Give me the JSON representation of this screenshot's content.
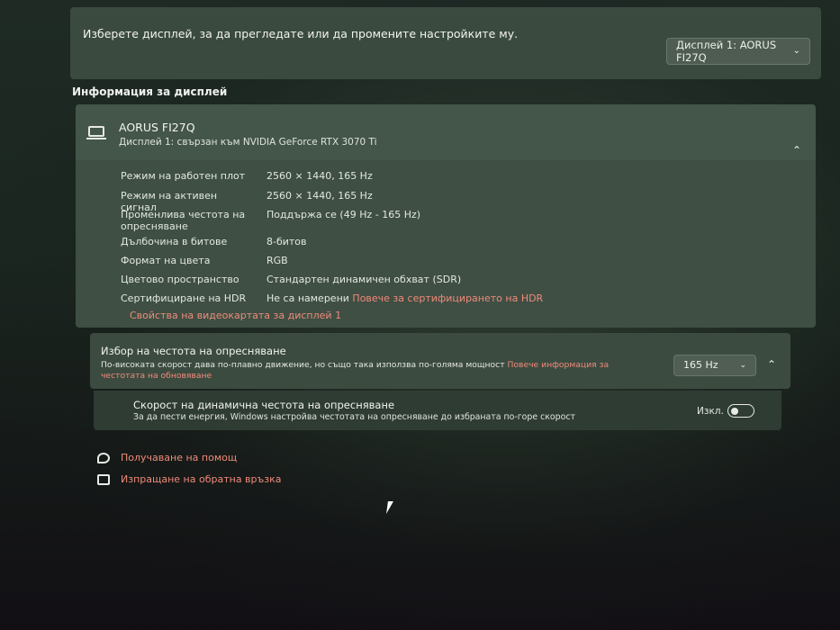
{
  "top_panel": {
    "prompt": "Изберете дисплей, за да прегледате или да промените настройките му.",
    "display_select": "Дисплей 1: AORUS FI27Q"
  },
  "section_title": "Информация за дисплей",
  "display_info": {
    "name": "AORUS FI27Q",
    "subtitle": "Дисплей 1: свързан към NVIDIA GeForce RTX 3070 Ti",
    "rows": [
      {
        "label": "Режим на работен плот",
        "value": "2560 × 1440, 165 Hz"
      },
      {
        "label": "Режим на активен сигнал",
        "value": "2560 × 1440, 165 Hz"
      },
      {
        "label": "Променлива честота на опресняване",
        "value": "Поддържа се (49 Hz - 165 Hz)"
      },
      {
        "label": "Дълбочина в битове",
        "value": "8-битов"
      },
      {
        "label": "Формат на цвета",
        "value": "RGB"
      },
      {
        "label": "Цветово пространство",
        "value": "Стандартен динамичен обхват (SDR)"
      },
      {
        "label": "Сертифициране на HDR",
        "value": "Не са намерени",
        "link": "Повече за сертифицирането на HDR"
      }
    ],
    "gpu_link": "Свойства на видеокартата за дисплей 1"
  },
  "refresh_rate": {
    "title": "Избор на честота на опресняване",
    "description": "По-високата скорост дава по-плавно движение, но също така използва по-голяма мощност",
    "link": "Повече информация за честотата на обновяване",
    "selected": "165 Hz"
  },
  "dynamic_refresh": {
    "title": "Скорост на динамична честота на опресняване",
    "description": "За да пести енергия, Windows настройва честотата на опресняване до избраната по-горе скорост",
    "toggle_label": "Изкл."
  },
  "help_links": {
    "get_help": "Получаване на помощ",
    "feedback": "Изпращане на обратна връзка"
  },
  "colors": {
    "link": "#f08a7a",
    "card": "#3f4f43"
  },
  "icons": [
    "chevron-down-icon",
    "monitor-icon",
    "chevron-up-icon",
    "help-icon",
    "feedback-icon",
    "cursor-icon"
  ]
}
